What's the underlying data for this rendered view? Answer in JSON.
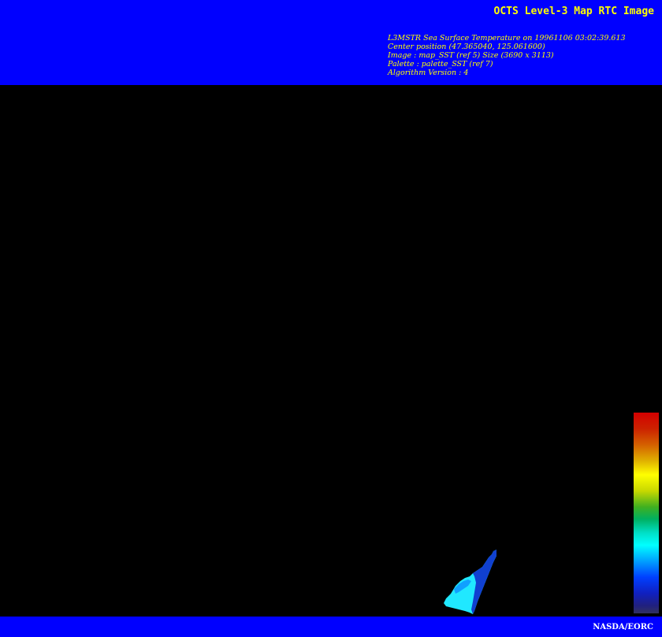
{
  "header": {
    "title": "OCTS Level-3 Map RTC Image",
    "info_lines": [
      "L3MSTR Sea Surface Temperature on 19961106 03:02:39.613",
      "Center position (47.365040, 125.061600)",
      "Image : map_SST (ref 5) Size (3690 x 3113)",
      "Palette : palette_SST (ref 7)",
      "Algorithm Version : 4"
    ]
  },
  "footer": {
    "credit": "NASDA/EORC"
  },
  "colors": {
    "banner": "#0000ff",
    "title_text": "#ffff00",
    "credit_text": "#ffffff",
    "background": "#000000",
    "data_swath": "#20e8ff",
    "data_swath_dark": "#1040d0"
  }
}
